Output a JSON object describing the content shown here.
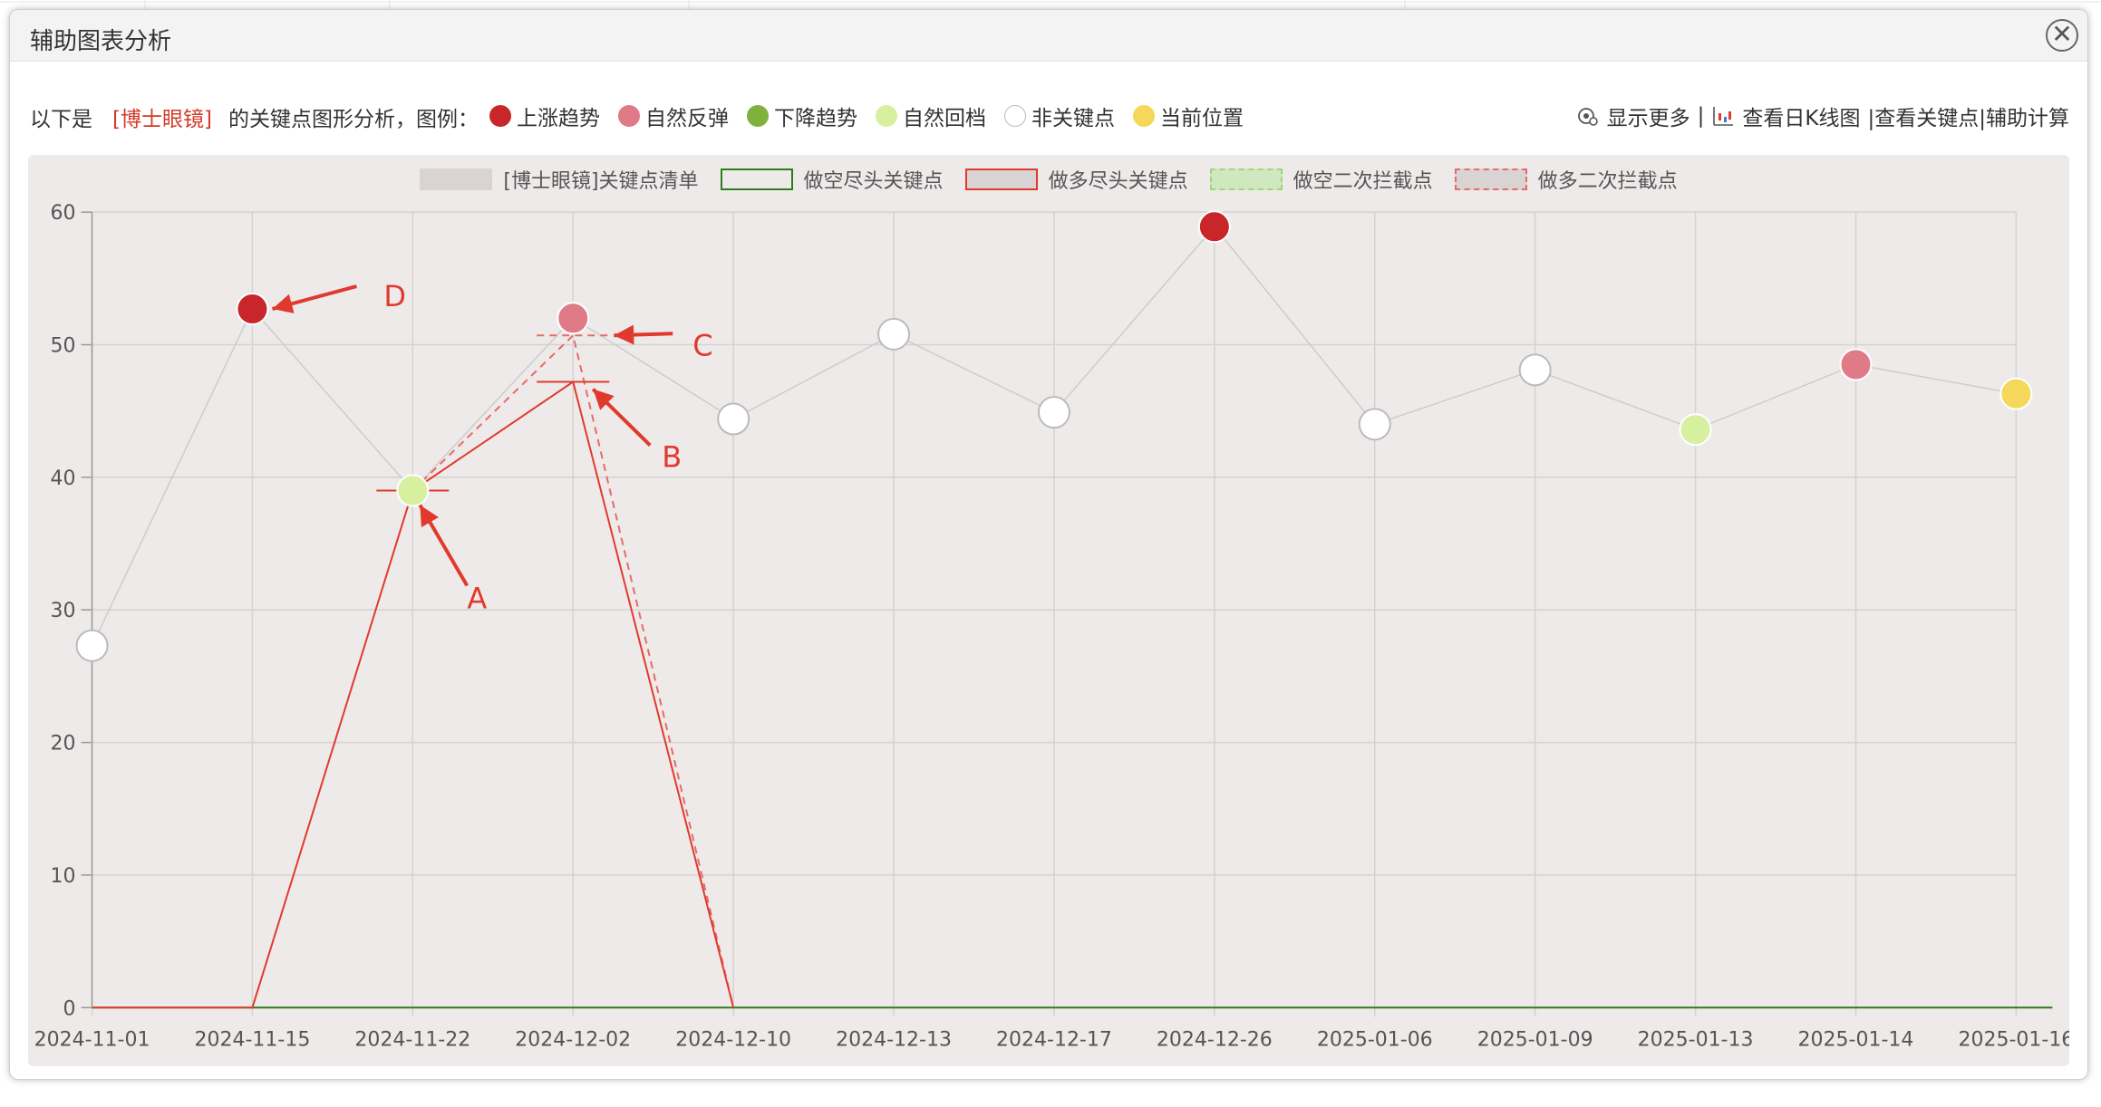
{
  "modal": {
    "title": "辅助图表分析",
    "close_symbol": "✕"
  },
  "info": {
    "prefix": "以下是",
    "stock_name": "[博士眼镜]",
    "suffix": "的关键点图形分析，图例：",
    "legend": [
      {
        "label": "上涨趋势",
        "color": "#c8262a"
      },
      {
        "label": "自然反弹",
        "color": "#e07a86"
      },
      {
        "label": "下降趋势",
        "color": "#7fb23c"
      },
      {
        "label": "自然回档",
        "color": "#d7f0a0"
      },
      {
        "label": "非关键点",
        "color": "#ffffff"
      },
      {
        "label": "当前位置",
        "color": "#f5d75a"
      }
    ],
    "show_more": "显示更多",
    "separator": "|",
    "view_k": "查看日K线图",
    "view_key": "|查看关键点",
    "aux_calc": "|辅助计算",
    "icons": {
      "show_more": "eye-icon",
      "view_k": "candlestick-chart-icon"
    }
  },
  "chart_data": {
    "type": "line",
    "categories": [
      "2024-11-01",
      "2024-11-15",
      "2024-11-22",
      "2024-12-02",
      "2024-12-10",
      "2024-12-13",
      "2024-12-17",
      "2024-12-26",
      "2025-01-06",
      "2025-01-09",
      "2025-01-13",
      "2025-01-14",
      "2025-01-16"
    ],
    "ylim": [
      0,
      60
    ],
    "yticks": [
      0,
      10,
      20,
      30,
      40,
      50,
      60
    ],
    "grid": true,
    "legend_position": "top-center",
    "series": [
      {
        "name": "[博士眼镜]关键点清单",
        "color": "#cccccc",
        "values": [
          27.3,
          52.7,
          39.0,
          52.0,
          44.4,
          50.8,
          44.9,
          58.9,
          44.0,
          48.1,
          43.6,
          48.5,
          46.3
        ],
        "point_types": [
          "非关键点",
          "上涨趋势",
          "自然回档",
          "自然反弹",
          "非关键点",
          "非关键点",
          "非关键点",
          "上涨趋势",
          "非关键点",
          "非关键点",
          "自然回档",
          "自然反弹",
          "当前位置"
        ]
      },
      {
        "name": "做空尽头关键点",
        "color": "#2f7a1f",
        "values": [
          0,
          0,
          0,
          0,
          0,
          0,
          0,
          0,
          0,
          0,
          0,
          0,
          0
        ]
      },
      {
        "name": "做多尽头关键点",
        "color": "#e03a2e",
        "values": [
          0,
          0,
          39.0,
          47.2,
          0,
          null,
          null,
          null,
          null,
          null,
          null,
          null,
          null
        ]
      },
      {
        "name": "做空二次拦截点",
        "color": "#9fd67a",
        "values": [
          null,
          null,
          null,
          null,
          null,
          null,
          null,
          null,
          null,
          null,
          null,
          null,
          null
        ]
      },
      {
        "name": "做多二次拦截点",
        "color": "#e66b66",
        "values": [
          null,
          null,
          39.0,
          50.7,
          0,
          null,
          null,
          null,
          null,
          null,
          null,
          null,
          null
        ]
      }
    ],
    "annotations": [
      {
        "label": "A",
        "category": "2024-11-22",
        "value": 39.0
      },
      {
        "label": "B",
        "category": "2024-12-02",
        "value": 47.2
      },
      {
        "label": "C",
        "category": "2024-12-02",
        "value": 50.7
      },
      {
        "label": "D",
        "category": "2024-11-15",
        "value": 52.7
      }
    ]
  }
}
